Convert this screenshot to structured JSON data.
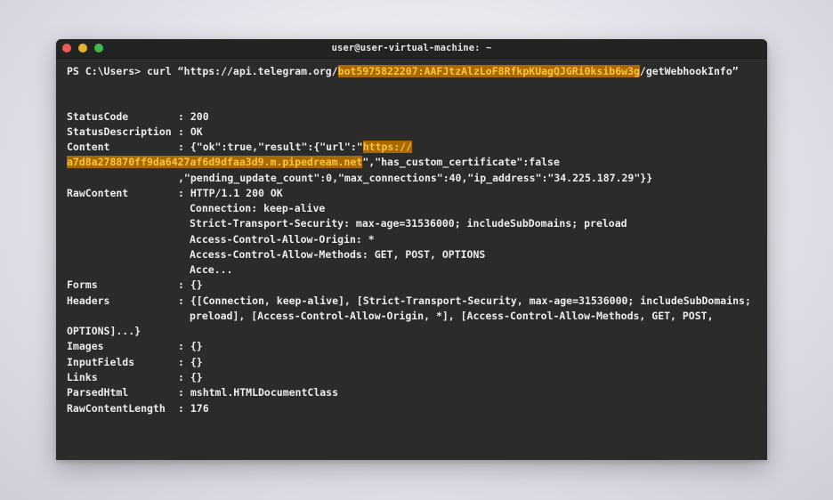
{
  "window": {
    "title": "user@user-virtual-machine: ~"
  },
  "command": {
    "prompt": "PS C:\\Users> curl “https://api.telegram.org/",
    "token": "bot5975822207:AAFJtzAlzLoF8RfkpKUagQJGRi0ksib6w3g",
    "suffix": "/getWebhookInfo”"
  },
  "output": {
    "status_code_key": "StatusCode",
    "status_code_val": ": 200",
    "status_desc_key": "StatusDescription",
    "status_desc_val": ": OK",
    "content_key": "Content",
    "content_val_prefix": ": {\"ok\":true,\"result\":{\"url\":\"",
    "content_url_part1": "https://",
    "content_url_part2": "a7d8a278870ff9da6427af6d9dfaa3d9.m.pipedream.net",
    "content_line2_rest": "\",\"has_custom_certificate\":false",
    "content_line3": ",\"pending_update_count\":0,\"max_connections\":40,\"ip_address\":\"34.225.187.29\"}}",
    "raw_key": "RawContent",
    "raw_val": ": HTTP/1.1 200 OK",
    "raw_lines": [
      "Connection: keep-alive",
      "Strict-Transport-Security: max-age=31536000; includeSubDomains; preload",
      "Access-Control-Allow-Origin: *",
      "Access-Control-Allow-Methods: GET, POST, OPTIONS",
      "Acce..."
    ],
    "forms_key": "Forms",
    "forms_val": ": {}",
    "headers_key": "Headers",
    "headers_val1": ": {[Connection, keep-alive], [Strict-Transport-Security, max-age=31536000; includeSubDomains;",
    "headers_val2": "preload], [Access-Control-Allow-Origin, *], [Access-Control-Allow-Methods, GET, POST,",
    "headers_val3": "OPTIONS]...}",
    "images_key": "Images",
    "images_val": ": {}",
    "inputfields_key": "InputFields",
    "inputfields_val": ": {}",
    "links_key": "Links",
    "links_val": ": {}",
    "parsedhtml_key": "ParsedHtml",
    "parsedhtml_val": ": mshtml.HTMLDocumentClass",
    "rawlen_key": "RawContentLength",
    "rawlen_val": ": 176"
  },
  "colors": {
    "terminal_bg": "#2b2b2b",
    "highlight_bg": "#a86a00",
    "highlight_fg": "#ffc23a",
    "close": "#ee5b53",
    "minimize": "#e6b12d",
    "maximize": "#3cba4f"
  }
}
